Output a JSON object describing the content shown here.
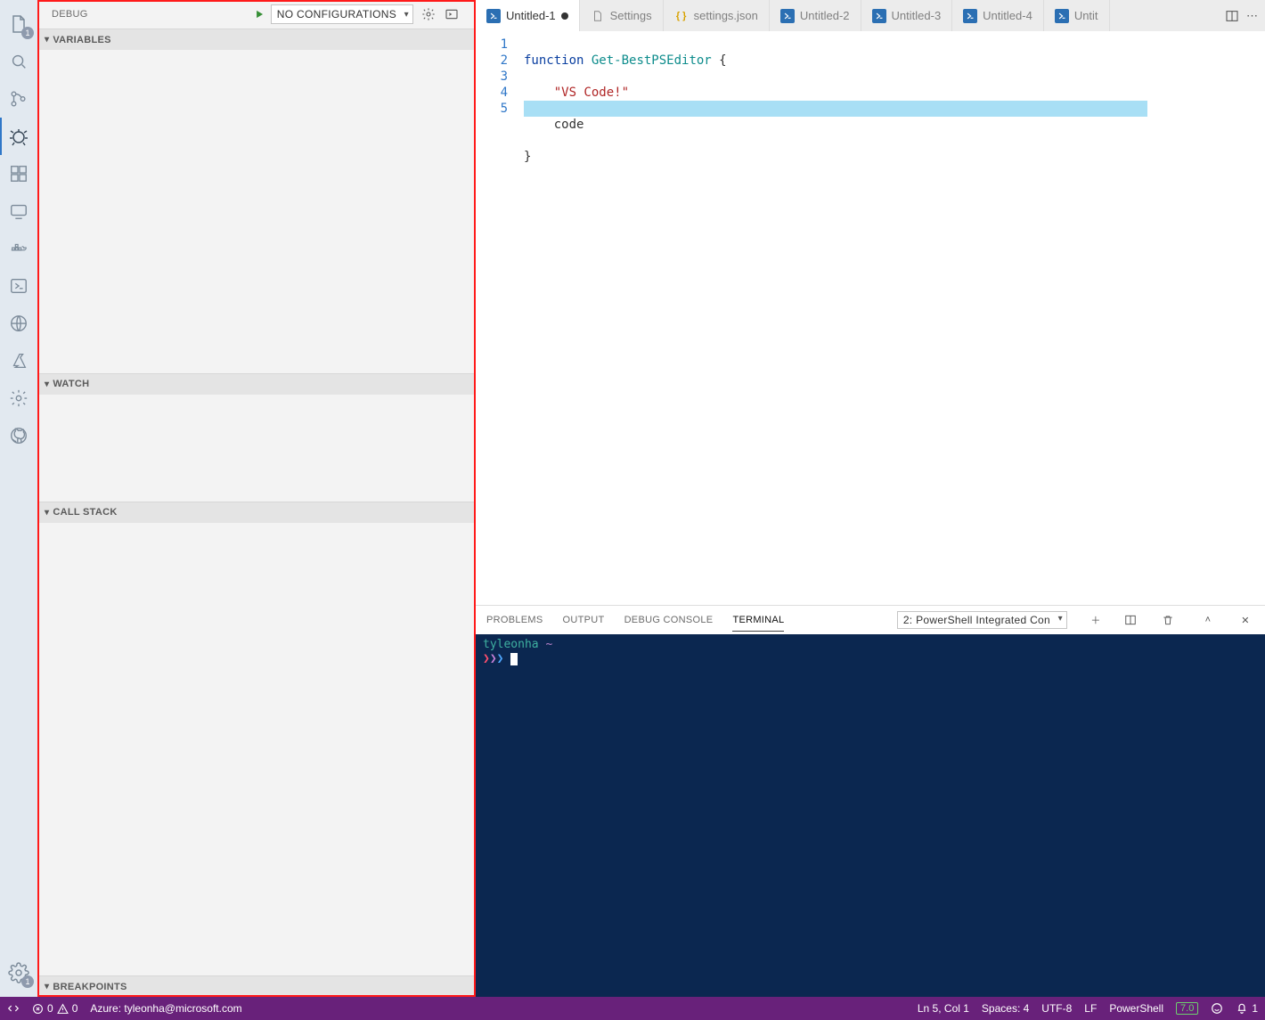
{
  "activitybar": {
    "explorer_badge": "1",
    "settings_badge": "1"
  },
  "sidebar": {
    "title": "DEBUG",
    "config": "No Configurations",
    "sections": {
      "variables": "Variables",
      "watch": "Watch",
      "callstack": "Call Stack",
      "breakpoints": "Breakpoints"
    }
  },
  "tabs": [
    {
      "label": "Untitled-1",
      "icon": "ps",
      "active": true,
      "dirty": true
    },
    {
      "label": "Settings",
      "icon": "file",
      "active": false,
      "dirty": false
    },
    {
      "label": "settings.json",
      "icon": "json",
      "active": false,
      "dirty": false
    },
    {
      "label": "Untitled-2",
      "icon": "ps",
      "active": false,
      "dirty": false
    },
    {
      "label": "Untitled-3",
      "icon": "ps",
      "active": false,
      "dirty": false
    },
    {
      "label": "Untitled-4",
      "icon": "ps",
      "active": false,
      "dirty": false
    },
    {
      "label": "Untit",
      "icon": "ps",
      "active": false,
      "dirty": false
    }
  ],
  "code": {
    "lines": [
      "1",
      "2",
      "3",
      "4",
      "5"
    ],
    "kw_function": "function",
    "fn_name": "Get-BestPSEditor",
    "brace_open": "{",
    "string_line": "\"VS Code!\"",
    "code_line": "code",
    "brace_close": "}"
  },
  "panel": {
    "tabs": {
      "problems": "PROBLEMS",
      "output": "OUTPUT",
      "debugconsole": "DEBUG CONSOLE",
      "terminal": "TERMINAL"
    },
    "terminal_selector": "2: PowerShell Integrated Con",
    "terminal_user": "tyleonha",
    "terminal_path": "~"
  },
  "statusbar": {
    "errors": "0",
    "warnings": "0",
    "azure": "Azure: tyleonha@microsoft.com",
    "ln_col": "Ln 5, Col 1",
    "spaces": "Spaces: 4",
    "encoding": "UTF-8",
    "eol": "LF",
    "language": "PowerShell",
    "psver": "7.0",
    "notifications": "1"
  }
}
